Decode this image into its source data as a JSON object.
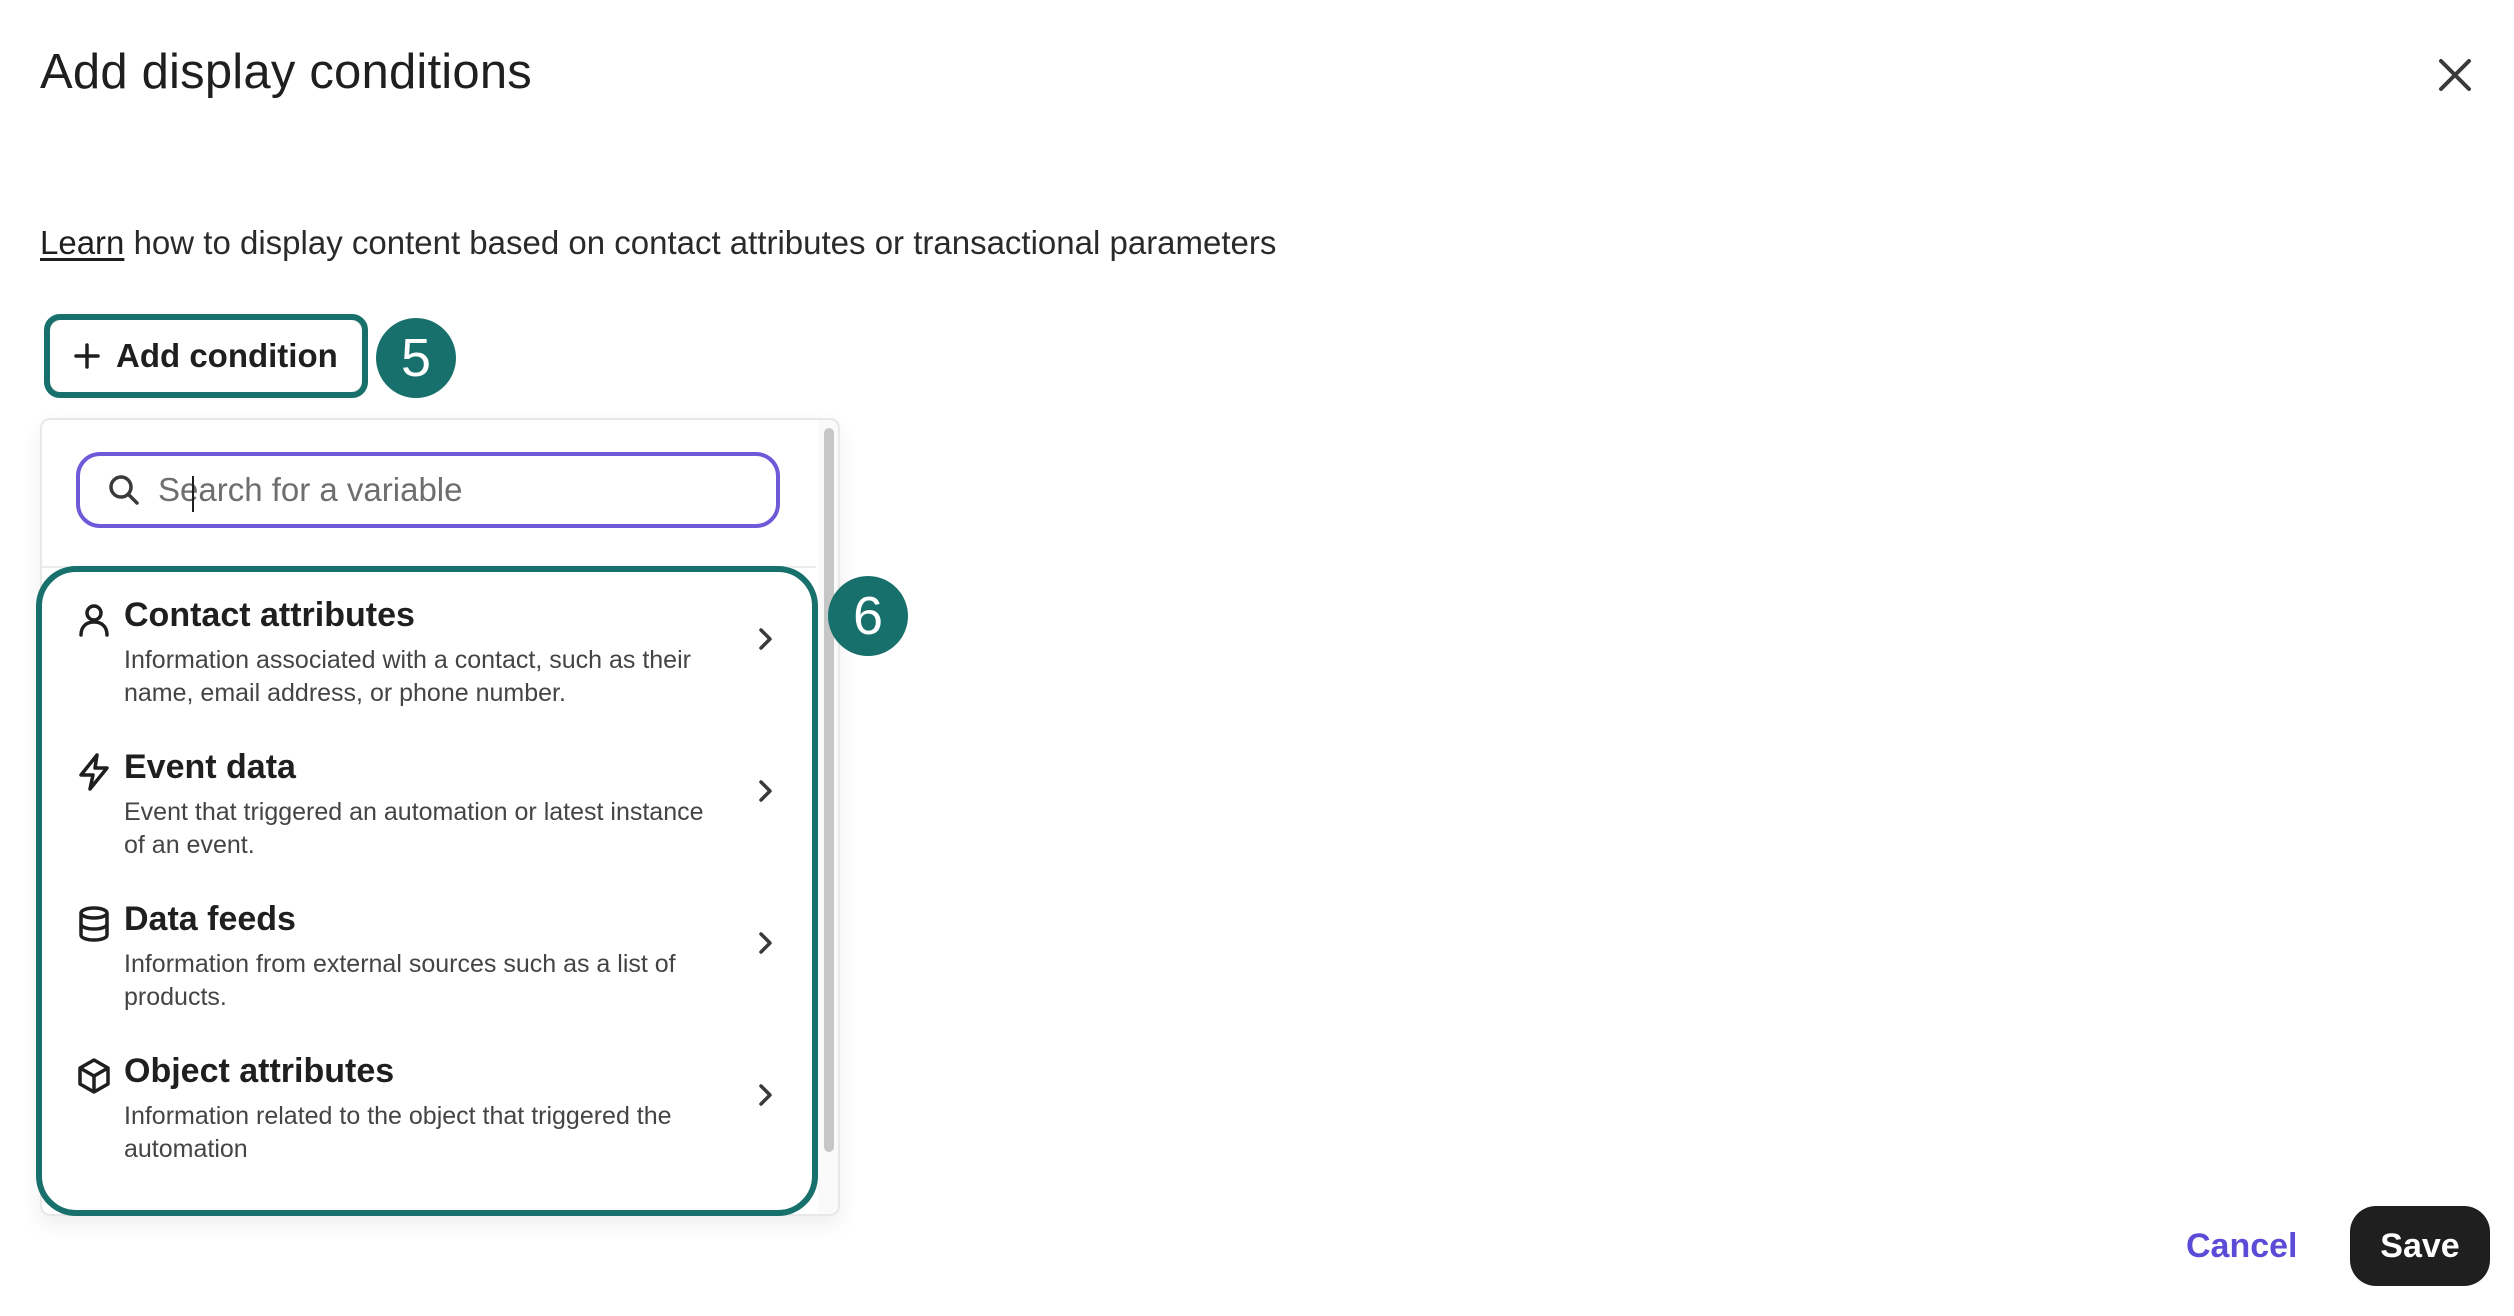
{
  "dialog": {
    "title": "Add display conditions",
    "close_icon": "close-icon"
  },
  "intro": {
    "link_text": "Learn",
    "text": " how to display content based on contact attributes or transactional parameters"
  },
  "add_condition": {
    "label": "Add condition",
    "icon": "plus-icon"
  },
  "callouts": {
    "step_add": "5",
    "step_list": "6",
    "color": "#17706b"
  },
  "search": {
    "placeholder": "Search for a variable",
    "value": "",
    "icon": "search-icon"
  },
  "options": [
    {
      "icon": "person-icon",
      "name": "Contact attributes",
      "desc_line1": "Information associated with a contact, such as their",
      "desc_line2": "name, email address, or phone number."
    },
    {
      "icon": "lightning-icon",
      "name": "Event data",
      "desc_line1": "Event that triggered an automation or latest instance",
      "desc_line2": "of an event."
    },
    {
      "icon": "database-icon",
      "name": "Data feeds",
      "desc_line1": "Information from external sources such as a list of",
      "desc_line2": "products."
    },
    {
      "icon": "cube-icon",
      "name": "Object attributes",
      "desc_line1": "Information related to the object that triggered the",
      "desc_line2": "automation"
    }
  ],
  "footer": {
    "cancel_label": "Cancel",
    "save_label": "Save"
  },
  "colors": {
    "accent": "#5b4bd6",
    "callout": "#17706b",
    "primary_button": "#1f1f1f"
  }
}
